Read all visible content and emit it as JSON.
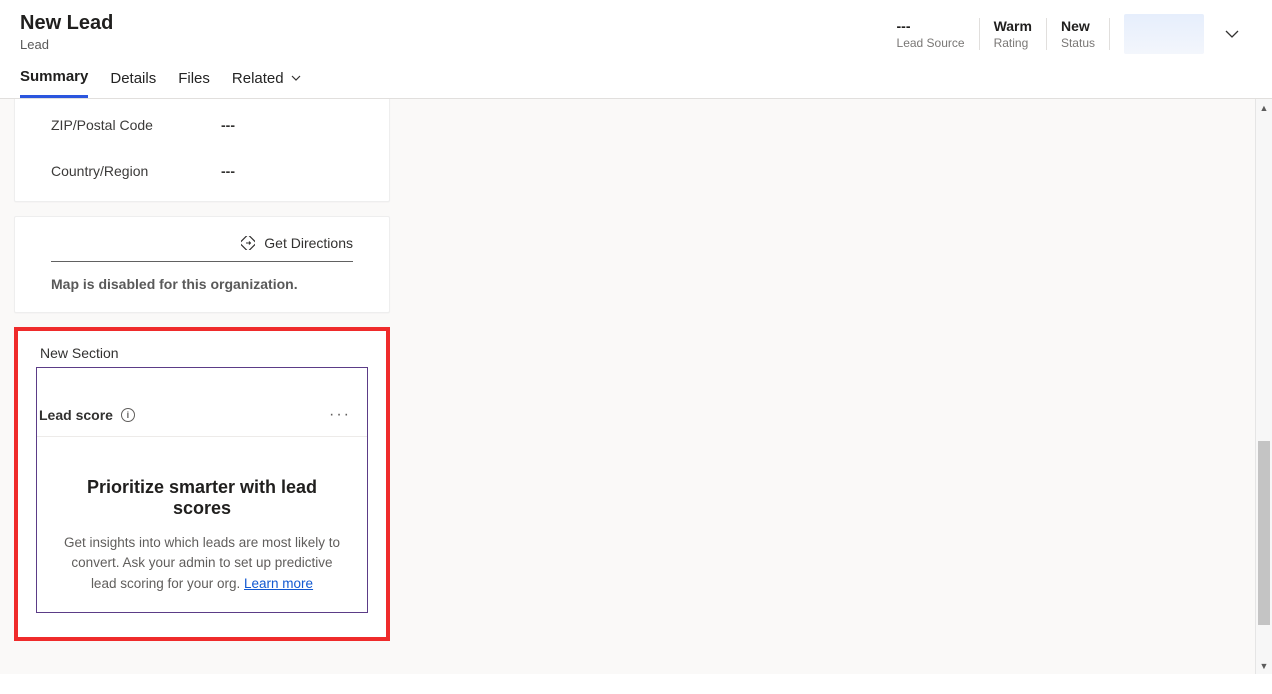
{
  "header": {
    "title": "New Lead",
    "entity": "Lead"
  },
  "stats": {
    "lead_source_value": "---",
    "lead_source_label": "Lead Source",
    "rating_value": "Warm",
    "rating_label": "Rating",
    "status_value": "New",
    "status_label": "Status"
  },
  "tabs": {
    "summary": "Summary",
    "details": "Details",
    "files": "Files",
    "related": "Related"
  },
  "address": {
    "zip_label": "ZIP/Postal Code",
    "zip_value": "---",
    "country_label": "Country/Region",
    "country_value": "---"
  },
  "map": {
    "get_directions": "Get Directions",
    "disabled_msg": "Map is disabled for this organization."
  },
  "new_section": {
    "title": "New Section",
    "lead_score_label": "Lead score",
    "promo_heading": "Prioritize smarter with lead scores",
    "promo_text": "Get insights into which leads are most likely to convert. Ask your admin to set up predictive lead scoring for your org. ",
    "learn_more": "Learn more"
  }
}
